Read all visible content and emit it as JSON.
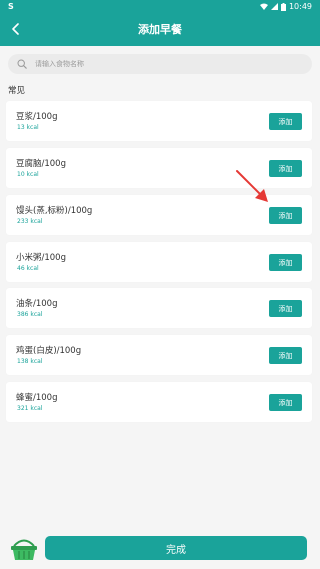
{
  "status_bar": {
    "app_badge": "S",
    "time": "10:49"
  },
  "header": {
    "title": "添加早餐"
  },
  "search": {
    "placeholder": "请输入食物名称"
  },
  "section": {
    "title": "常见"
  },
  "foods": [
    {
      "name": "豆浆/100g",
      "kcal": "13 kcal",
      "add_label": "添加"
    },
    {
      "name": "豆腐脑/100g",
      "kcal": "10 kcal",
      "add_label": "添加"
    },
    {
      "name": "馒头(蒸,标粉)/100g",
      "kcal": "233 kcal",
      "add_label": "添加"
    },
    {
      "name": "小米粥/100g",
      "kcal": "46 kcal",
      "add_label": "添加"
    },
    {
      "name": "油条/100g",
      "kcal": "386 kcal",
      "add_label": "添加"
    },
    {
      "name": "鸡蛋(白皮)/100g",
      "kcal": "138 kcal",
      "add_label": "添加"
    },
    {
      "name": "蜂蜜/100g",
      "kcal": "321 kcal",
      "add_label": "添加"
    }
  ],
  "footer": {
    "done_label": "完成"
  },
  "colors": {
    "accent": "#1aa39a",
    "annotation_arrow": "#e53935",
    "basket": "#2e9d4f"
  }
}
